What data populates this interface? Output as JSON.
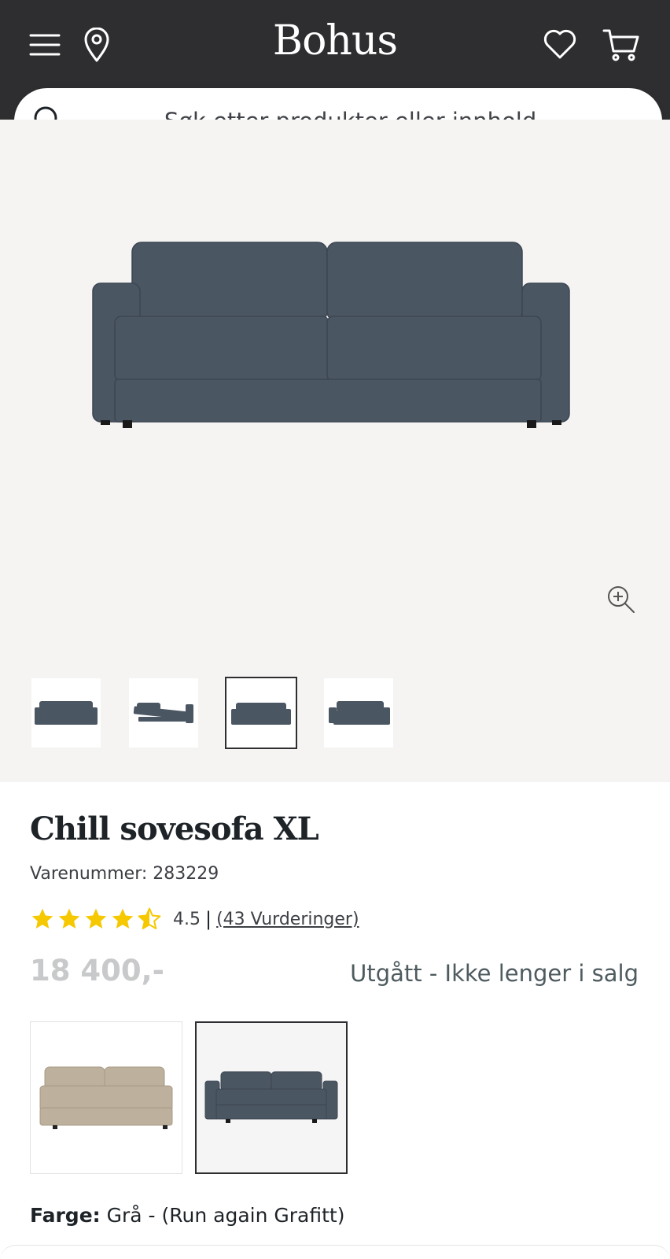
{
  "header": {
    "logo": "Bohus",
    "icons": {
      "menu": "menu-icon",
      "location": "location-pin-icon",
      "wishlist": "heart-icon",
      "cart": "cart-icon"
    }
  },
  "search": {
    "placeholder": "Søk etter produkter eller innhold ..."
  },
  "gallery": {
    "thumbnails": [
      {
        "alt": "sofa-front"
      },
      {
        "alt": "sofa-bed-extended"
      },
      {
        "alt": "sofa-front-selected"
      },
      {
        "alt": "sofa-angle"
      }
    ],
    "selected_index": 2
  },
  "product": {
    "title": "Chill sovesofa XL",
    "sku": "Varenummer: 283229",
    "rating": {
      "value": "4.5",
      "separator": "|",
      "reviews": "(43 Vurderinger)",
      "stars": 4.5
    },
    "price": "18 400,-",
    "status": "Utgått - Ikke lenger i salg"
  },
  "variants": [
    {
      "name": "beige-sofa",
      "selected": false
    },
    {
      "name": "grey-blue-sofa",
      "selected": true
    }
  ],
  "color": {
    "label": "Farge:",
    "value": "Grå - (Run again Grafitt)"
  },
  "colors": {
    "header_bg": "#2e2e30",
    "star": "#f5c800",
    "gallery_bg": "#f5f4f2",
    "sofa": "#4b5663",
    "status": "#4e5b5f"
  }
}
